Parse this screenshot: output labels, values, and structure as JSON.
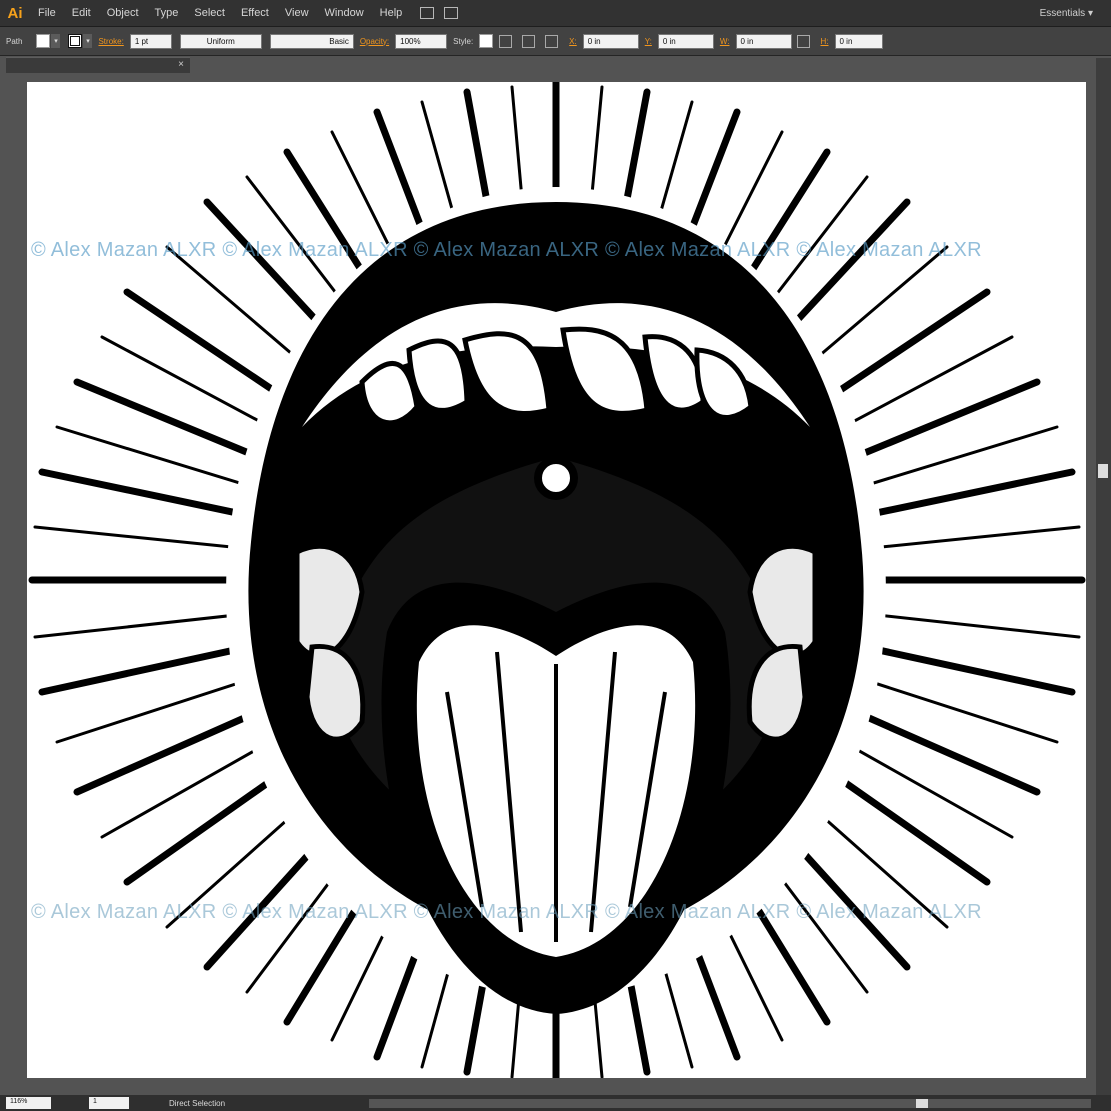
{
  "app": {
    "logo": "Ai",
    "menu": [
      "File",
      "Edit",
      "Object",
      "Type",
      "Select",
      "Effect",
      "View",
      "Window",
      "Help"
    ],
    "workspace": "Essentials"
  },
  "control_bar": {
    "selection_type": "Path",
    "stroke_label": "Stroke:",
    "stroke_weight": "1 pt",
    "variable_width_profile": "Uniform",
    "brush_definition": "Basic",
    "opacity_label": "Opacity:",
    "opacity_value": "100%",
    "style_label": "Style:",
    "x_label": "X:",
    "x_value": "0 in",
    "y_label": "Y:",
    "y_value": "0 in",
    "w_label": "W:",
    "w_value": "0 in",
    "h_label": "H:",
    "h_value": "0 in"
  },
  "document": {
    "tab_close": "×",
    "watermark_top": "© Alex Mazan ALXR © Alex Mazan ALXR © Alex Mazan ALXR © Alex Mazan ALXR © Alex Mazan ALXR",
    "watermark_bottom": "© Alex Mazan ALXR © Alex Mazan ALXR © Alex Mazan ALXR © Alex Mazan ALXR © Alex Mazan ALXR"
  },
  "status_bar": {
    "zoom": "116%",
    "artboard_number": "1",
    "tool_status": "Direct Selection"
  },
  "colors": {
    "ui_dark": "#323232",
    "control_gray": "#424242",
    "accent": "#f2961d",
    "canvas": "#ffffff"
  }
}
